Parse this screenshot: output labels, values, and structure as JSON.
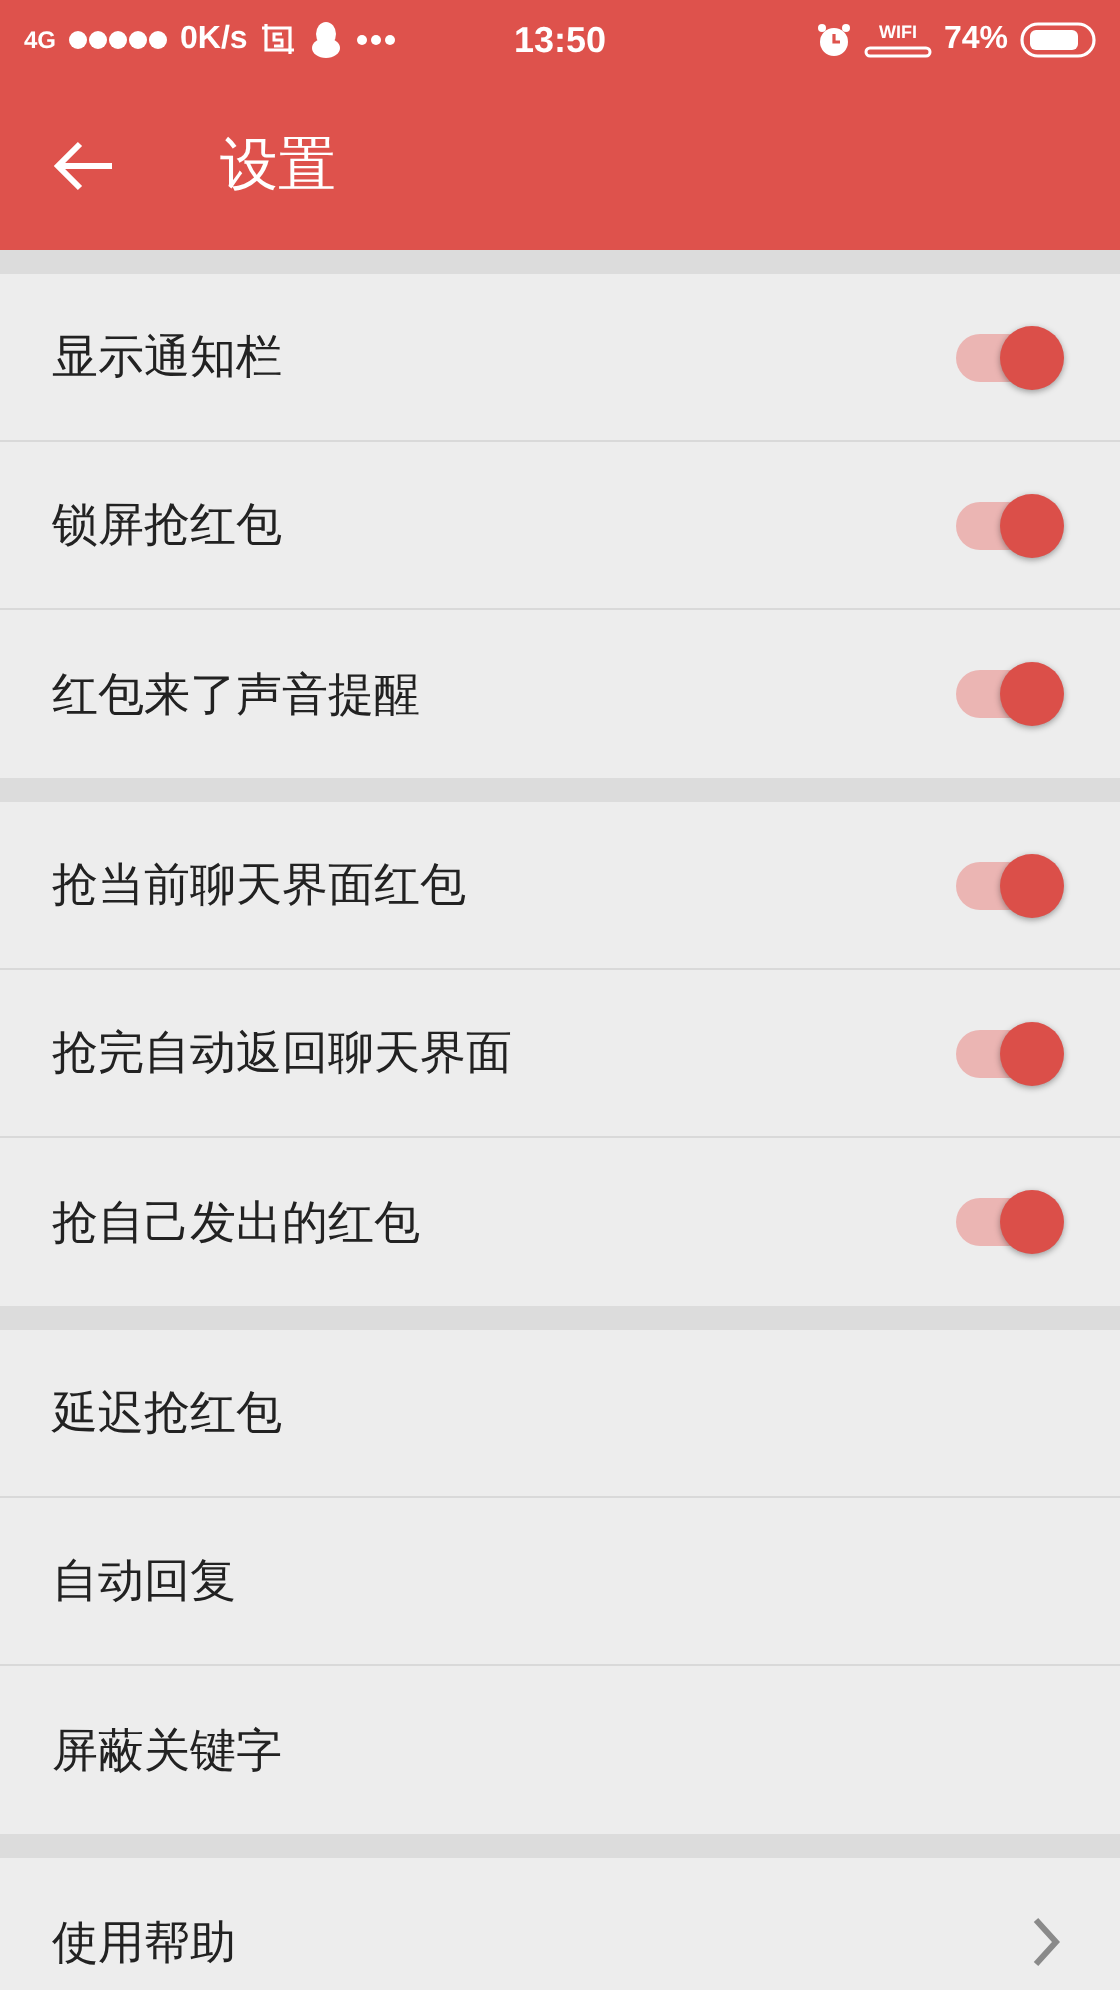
{
  "status_bar": {
    "network": "4G",
    "speed": "0K/s",
    "time": "13:50",
    "wifi_label": "WIFI",
    "battery": "74%"
  },
  "header": {
    "title": "设置"
  },
  "sections": [
    {
      "items": [
        {
          "label": "显示通知栏",
          "kind": "toggle",
          "on": true
        },
        {
          "label": "锁屏抢红包",
          "kind": "toggle",
          "on": true
        },
        {
          "label": "红包来了声音提醒",
          "kind": "toggle",
          "on": true
        }
      ]
    },
    {
      "items": [
        {
          "label": "抢当前聊天界面红包",
          "kind": "toggle",
          "on": true
        },
        {
          "label": "抢完自动返回聊天界面",
          "kind": "toggle",
          "on": true
        },
        {
          "label": "抢自己发出的红包",
          "kind": "toggle",
          "on": true
        }
      ]
    },
    {
      "items": [
        {
          "label": "延迟抢红包",
          "kind": "plain"
        },
        {
          "label": "自动回复",
          "kind": "plain"
        },
        {
          "label": "屏蔽关键字",
          "kind": "plain"
        }
      ]
    },
    {
      "items": [
        {
          "label": "使用帮助",
          "kind": "link"
        }
      ]
    }
  ]
}
